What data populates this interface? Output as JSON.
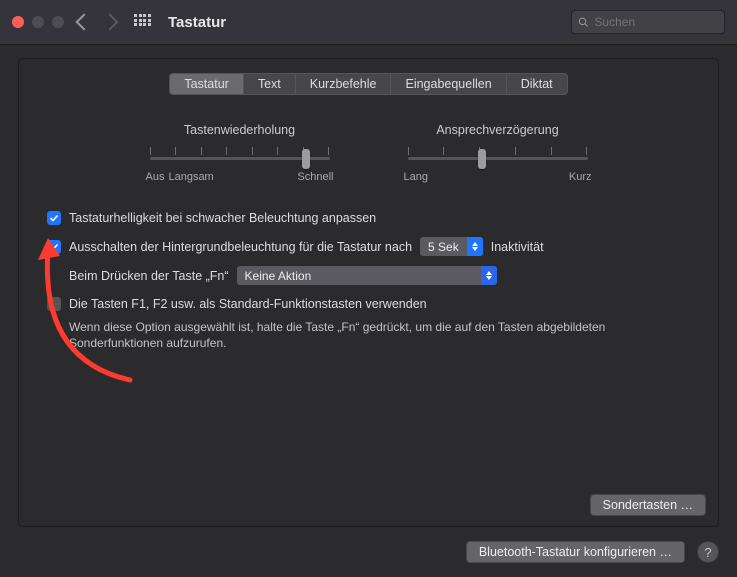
{
  "title": "Tastatur",
  "search": {
    "placeholder": "Suchen"
  },
  "tabs": [
    "Tastatur",
    "Text",
    "Kurzbefehle",
    "Eingabequellen",
    "Diktat"
  ],
  "sliders": {
    "repeat": {
      "label": "Tastenwiederholung",
      "left": "Aus",
      "left2": "Langsam",
      "right": "Schnell"
    },
    "delay": {
      "label": "Ansprechverzögerung",
      "left": "Lang",
      "right": "Kurz"
    }
  },
  "options": {
    "brightness_adjust": "Tastaturhelligkeit bei schwacher Beleuchtung anpassen",
    "backlight_off_pre": "Ausschalten der Hintergrundbeleuchtung für die Tastatur nach",
    "backlight_off_select": "5 Sek",
    "backlight_off_post": "Inaktivität",
    "fn_label": "Beim Drücken der Taste „Fn“",
    "fn_select": "Keine Aktion",
    "std_fn": "Die Tasten F1, F2 usw. als Standard-Funktionstasten verwenden",
    "std_fn_help": "Wenn diese Option ausgewählt ist, halte die Taste „Fn“ gedrückt, um die auf den Tasten abgebildeten Sonderfunktionen aufzurufen."
  },
  "buttons": {
    "sondertasten": "Sondertasten …",
    "bluetooth": "Bluetooth-Tastatur konfigurieren …"
  }
}
